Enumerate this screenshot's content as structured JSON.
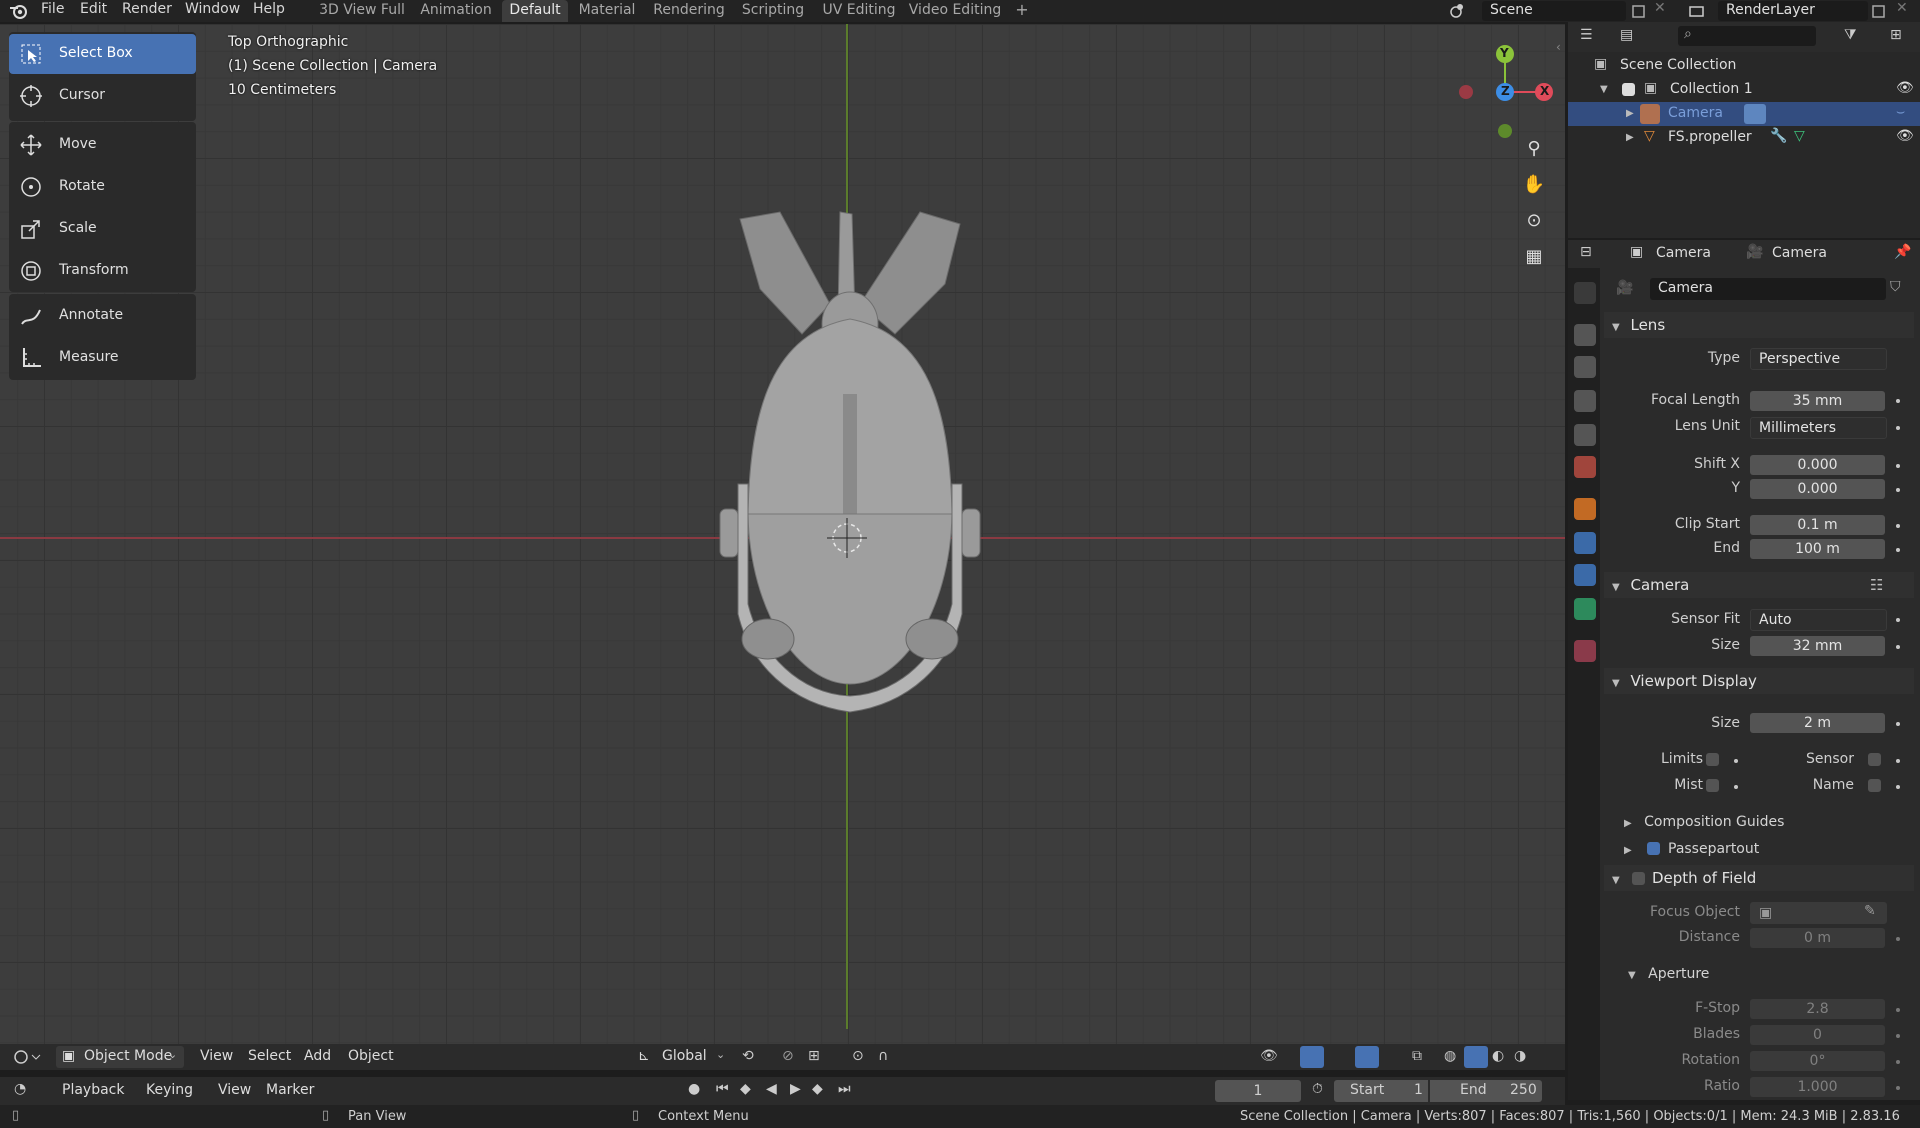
{
  "top_menu": [
    "File",
    "Edit",
    "Render",
    "Window",
    "Help"
  ],
  "workspaces": [
    "3D View Full",
    "Animation",
    "Default",
    "Material",
    "Rendering",
    "Scripting",
    "UV Editing",
    "Video Editing"
  ],
  "active_workspace": "Default",
  "add_workspace": "+",
  "scene_name": "Scene",
  "view_layer": "RenderLayer",
  "toolbar": {
    "tools": [
      "Select Box",
      "Cursor",
      "Move",
      "Rotate",
      "Scale",
      "Transform",
      "Annotate",
      "Measure"
    ],
    "active": "Select Box"
  },
  "viewport": {
    "view_name": "Top Orthographic",
    "collection_info": "(1) Scene Collection | Camera",
    "scale": "10 Centimeters",
    "gizmo": {
      "x": "X",
      "y": "Y",
      "z": "Z"
    },
    "header": {
      "mode": "Object Mode",
      "menus": [
        "View",
        "Select",
        "Add",
        "Object"
      ],
      "orientation": "Global"
    }
  },
  "outliner": {
    "root": "Scene Collection",
    "items": [
      {
        "name": "Collection 1",
        "level": 1
      },
      {
        "name": "Camera",
        "level": 2,
        "selected": true
      },
      {
        "name": "FS.propeller",
        "level": 2
      }
    ]
  },
  "properties": {
    "tab_object": "Camera",
    "tab_data": "Camera",
    "data_name": "Camera",
    "lens": {
      "title": "Lens",
      "type_label": "Type",
      "type": "Perspective",
      "focal_label": "Focal Length",
      "focal": "35 mm",
      "unit_label": "Lens Unit",
      "unit": "Millimeters",
      "shiftx_label": "Shift X",
      "shiftx": "0.000",
      "shifty_label": "Y",
      "shifty": "0.000",
      "clipstart_label": "Clip Start",
      "clipstart": "0.1 m",
      "clipend_label": "End",
      "clipend": "100 m"
    },
    "camera": {
      "title": "Camera",
      "fit_label": "Sensor Fit",
      "fit": "Auto",
      "size_label": "Size",
      "size": "32 mm"
    },
    "viewport_display": {
      "title": "Viewport Display",
      "size_label": "Size",
      "size": "2 m",
      "limits": "Limits",
      "sensor": "Sensor",
      "mist": "Mist",
      "name": "Name",
      "composition": "Composition Guides",
      "passepartout": "Passepartout"
    },
    "dof": {
      "title": "Depth of Field",
      "focus_label": "Focus Object",
      "distance_label": "Distance",
      "distance": "0 m",
      "aperture": "Aperture",
      "fstop_label": "F-Stop",
      "fstop": "2.8",
      "blades_label": "Blades",
      "blades": "0",
      "rotation_label": "Rotation",
      "rotation": "0°",
      "ratio_label": "Ratio",
      "ratio": "1.000"
    }
  },
  "timeline": {
    "menus": [
      "Playback",
      "Keying",
      "View",
      "Marker"
    ],
    "current_frame": "1",
    "start_label": "Start",
    "start": "1",
    "end_label": "End",
    "end": "250"
  },
  "status": {
    "pan": "Pan View",
    "context": "Context Menu",
    "stats": "Scene Collection | Camera | Verts:807 | Faces:807 | Tris:1,560 | Objects:0/1 | Mem: 24.3 MiB | 2.83.16"
  },
  "colors": {
    "accent": "#4772b3",
    "selection": "#334d80",
    "x_axis": "#e04b5a",
    "y_axis": "#8bc33a",
    "z_axis": "#3d8ee6"
  }
}
